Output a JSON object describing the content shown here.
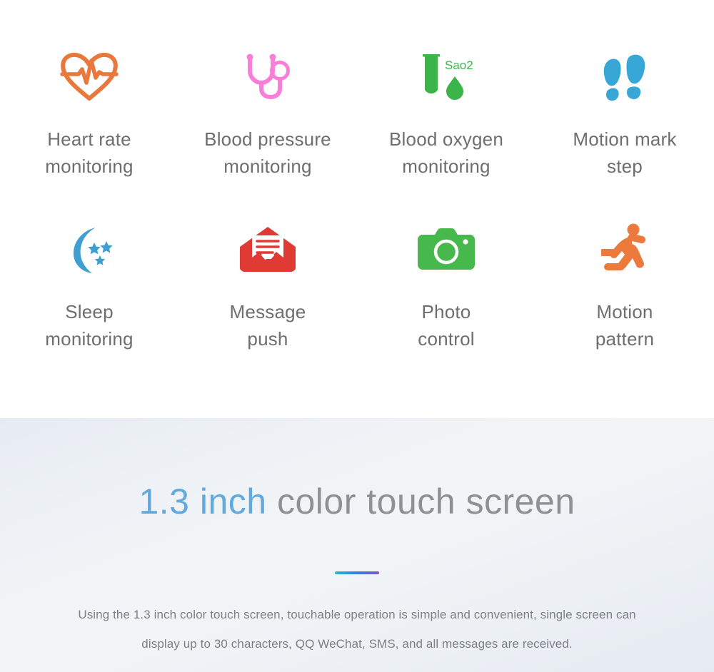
{
  "features": {
    "rows": [
      [
        {
          "icon": "heart-pulse-icon",
          "label": "Heart rate\nmonitoring",
          "color": "#e8783c"
        },
        {
          "icon": "stethoscope-icon",
          "label": "Blood pressure\nmonitoring",
          "color": "#f77fd8"
        },
        {
          "icon": "test-tube-sao2-icon",
          "label": "Blood oxygen\nmonitoring",
          "color": "#3bb54a",
          "icon_text": "Sao2"
        },
        {
          "icon": "footprints-icon",
          "label": "Motion mark\nstep",
          "color": "#38a7d8"
        }
      ],
      [
        {
          "icon": "moon-stars-icon",
          "label": "Sleep\nmonitoring",
          "color": "#3f9fd0"
        },
        {
          "icon": "envelope-message-icon",
          "label": "Message\npush",
          "color": "#e03a35"
        },
        {
          "icon": "camera-icon",
          "label": "Photo\ncontrol",
          "color": "#47b84c"
        },
        {
          "icon": "running-person-icon",
          "label": "Motion\npattern",
          "color": "#ec7a3c"
        }
      ]
    ]
  },
  "screen": {
    "heading_accent": "1.3 inch",
    "heading_rest": " color touch screen",
    "accent_color": "#62a9de",
    "divider_colors": [
      "#29b8d8",
      "#7e56c9"
    ],
    "description": "Using the 1.3 inch color touch screen, touchable operation is simple and convenient, single screen can display up to 30 characters, QQ WeChat, SMS, and all messages are received."
  }
}
